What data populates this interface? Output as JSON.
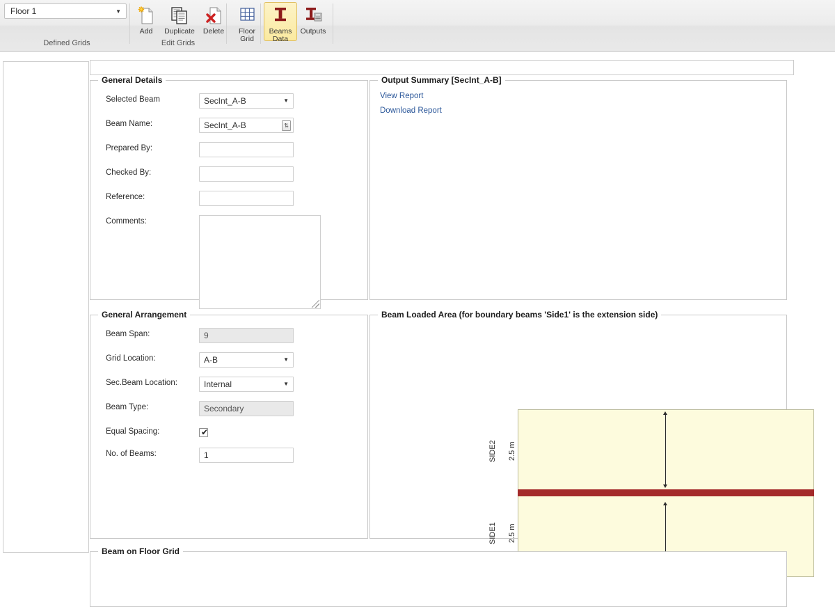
{
  "ribbon": {
    "floor_selector": {
      "value": "Floor 1",
      "arrow": "▼"
    },
    "groups": [
      {
        "label": "Defined Grids"
      },
      {
        "label": "Edit Grids"
      }
    ],
    "buttons": [
      {
        "label": "Add",
        "icon": "new-document-icon"
      },
      {
        "label": "Duplicate",
        "icon": "copy-document-icon"
      },
      {
        "label": "Delete",
        "icon": "delete-document-icon"
      },
      {
        "label": "Floor\nGrid",
        "line1": "Floor",
        "line2": "Grid",
        "icon": "grid-icon"
      },
      {
        "label": "Beams\nData",
        "line1": "Beams",
        "line2": "Data",
        "icon": "i-beam-icon",
        "active": true
      },
      {
        "label": "Outputs",
        "line1": "Outputs",
        "line2": "",
        "icon": "i-beam-calculator-icon"
      }
    ]
  },
  "general_details": {
    "title": "General Details",
    "fields": [
      {
        "label": "Selected Beam",
        "value": "SecInt_A-B",
        "type": "select"
      },
      {
        "label": "Beam Name:",
        "value": "SecInt_A-B",
        "type": "spinner"
      },
      {
        "label": "Prepared By:",
        "value": "",
        "type": "text"
      },
      {
        "label": "Checked By:",
        "value": "",
        "type": "text"
      },
      {
        "label": "Reference:",
        "value": "",
        "type": "text"
      },
      {
        "label": "Comments:",
        "value": "",
        "type": "textarea"
      }
    ]
  },
  "output_summary": {
    "title": "Output Summary [SecInt_A-B]",
    "links": [
      {
        "label": "View Report"
      },
      {
        "label": "Download Report"
      }
    ]
  },
  "general_arrangement": {
    "title": "General Arrangement",
    "fields": [
      {
        "label": "Beam Span:",
        "value": "9",
        "type": "readonly"
      },
      {
        "label": "Grid Location:",
        "value": "A-B",
        "type": "select"
      },
      {
        "label": "Sec.Beam Location:",
        "value": "Internal",
        "type": "select"
      },
      {
        "label": "Beam Type:",
        "value": "Secondary",
        "type": "readonly"
      },
      {
        "label": "Equal Spacing:",
        "value": "checked",
        "type": "checkbox"
      },
      {
        "label": "No. of Beams:",
        "value": "1",
        "type": "text"
      }
    ]
  },
  "beam_loaded_area": {
    "title": "Beam Loaded Area (for boundary beams 'Side1' is the extension side)",
    "side_top": {
      "name": "SIDE2",
      "dimension": "2.5 m"
    },
    "side_bottom": {
      "name": "SIDE1",
      "dimension": "2.5 m"
    },
    "colors": {
      "area_fill": "#fdfbdd",
      "beam": "#a42a2a"
    }
  },
  "beam_on_floor_grid": {
    "title": "Beam on Floor Grid"
  }
}
